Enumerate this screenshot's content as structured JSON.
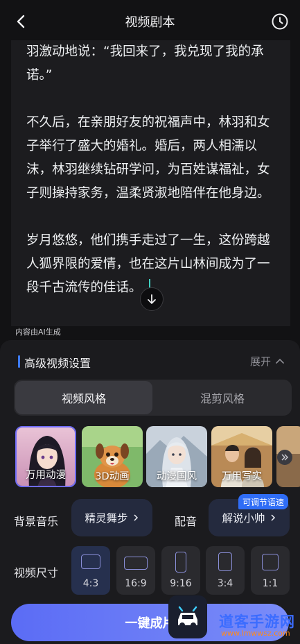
{
  "header": {
    "title": "视频剧本",
    "back_icon": "chevron-left-icon",
    "history_icon": "clock-icon"
  },
  "script": {
    "paragraphs": [
      "羽激动地说：“我回来了，我兑现了我的承诺。”",
      "不久后，在亲朋好友的祝福声中，林羽和女子举行了盛大的婚礼。婚后，两人相濡以沫，林羽继续钻研学问，为百姓谋福祉，女子则操持家务，温柔贤淑地陪伴在他身边。",
      "岁月悠悠，他们携手走过了一生，这份跨越人狐界限的爱情，也在这片山林间成为了一段千古流传的佳话。"
    ],
    "ai_note": "内容由AI生成"
  },
  "settings": {
    "section_title": "高级视频设置",
    "expand_label": "展开",
    "tabs": [
      {
        "label": "视频风格",
        "active": true
      },
      {
        "label": "混剪风格",
        "active": false
      }
    ],
    "styles": [
      {
        "label": "万用动漫",
        "selected": true
      },
      {
        "label": "3D动画",
        "selected": false
      },
      {
        "label": "动漫国风",
        "selected": false
      },
      {
        "label": "万用写实",
        "selected": false
      }
    ],
    "music_label": "背景音乐",
    "music_value": "精灵舞步",
    "voice_label": "配音",
    "voice_value": "解说小帅",
    "voice_badge": "可调节语速",
    "size_label": "视频尺寸",
    "ratios": [
      {
        "label": "4:3",
        "selected": true
      },
      {
        "label": "16:9",
        "selected": false
      },
      {
        "label": "9:16",
        "selected": false
      },
      {
        "label": "3:4",
        "selected": false
      },
      {
        "label": "1:1",
        "selected": false
      }
    ],
    "generate_label": "一键成片"
  },
  "watermark": {
    "text": "道客手游网",
    "url": "www.lmwwsz.com"
  },
  "colors": {
    "accent": "#3d7bff",
    "selected_border": "#6f6cf7",
    "cursor": "#3fd0c0"
  }
}
